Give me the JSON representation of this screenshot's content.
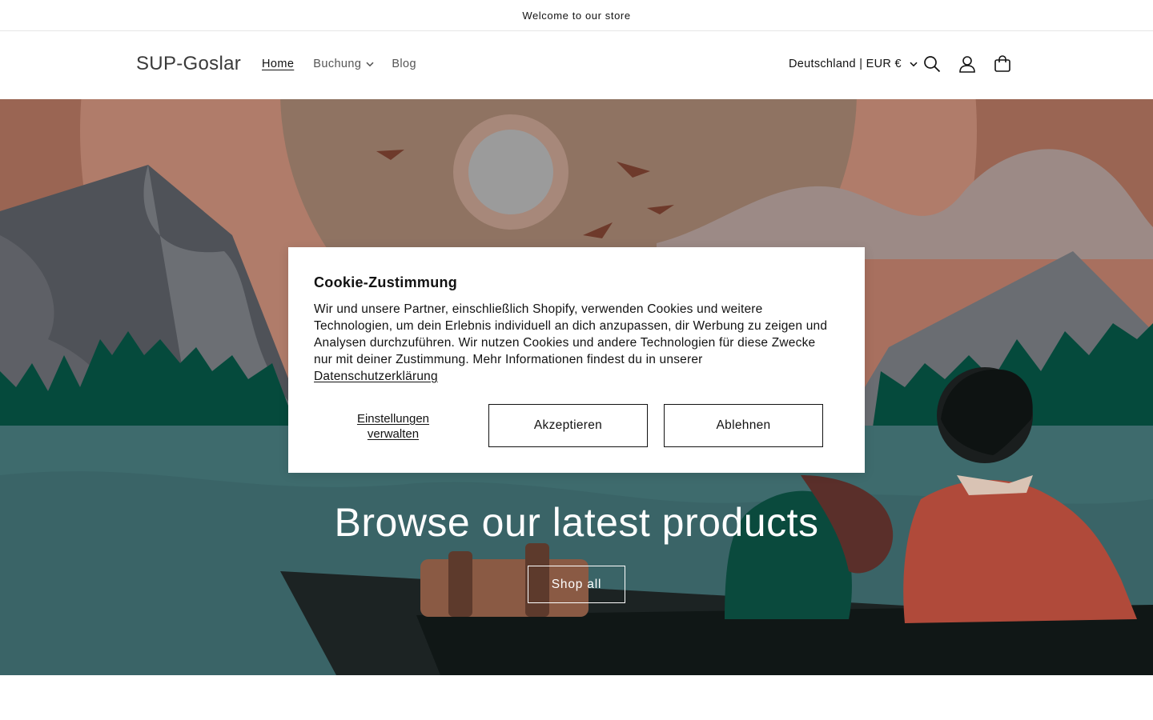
{
  "announcement": {
    "text": "Welcome to our store"
  },
  "header": {
    "logo": "SUP-Goslar",
    "nav": {
      "home": "Home",
      "buchung": "Buchung",
      "blog": "Blog"
    },
    "locale": "Deutschland | EUR €",
    "icons": [
      "search-icon",
      "account-icon",
      "cart-icon"
    ]
  },
  "hero": {
    "title": "Browse our latest products",
    "button": "Shop all"
  },
  "cookie": {
    "title": "Cookie-Zustimmung",
    "body": "Wir und unsere Partner, einschließlich Shopify, verwenden Cookies und weitere Technologien, um dein Erlebnis individuell an dich anzupassen, dir Werbung zu zeigen und Analysen durchzuführen. Wir nutzen Cookies und andere Technologien für diese Zwecke nur mit deiner Zustimmung. Mehr Informationen findest du in unserer",
    "privacy_link": "Datenschutzerklärung",
    "manage": "Einstellungen verwalten",
    "accept": "Akzeptieren",
    "decline": "Ablehnen"
  }
}
